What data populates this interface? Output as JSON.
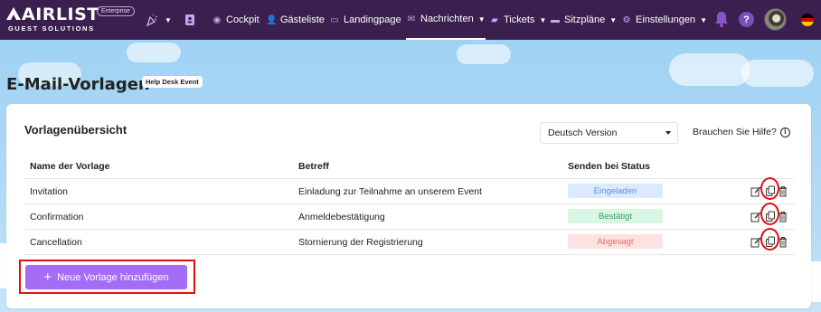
{
  "brand": {
    "name": "AIRLIST",
    "tagline": "GUEST SOLUTIONS",
    "badge": "Enterprise"
  },
  "nav": {
    "items": [
      {
        "label": "Cockpit",
        "icon": "dashboard-icon"
      },
      {
        "label": "Gästeliste",
        "icon": "guest-list-icon"
      },
      {
        "label": "Landingpage",
        "icon": "landingpage-icon"
      },
      {
        "label": "Nachrichten",
        "icon": "messages-icon",
        "active": true
      },
      {
        "label": "Tickets",
        "icon": "ticket-icon"
      },
      {
        "label": "Sitzpläne",
        "icon": "seating-icon"
      },
      {
        "label": "Einstellungen",
        "icon": "settings-icon"
      }
    ],
    "help": "?"
  },
  "page": {
    "title": "E-Mail-Vorlagen",
    "event_chip": "Help Desk Event"
  },
  "card": {
    "title": "Vorlagenübersicht",
    "language_select": "Deutsch Version",
    "help_link": "Brauchen Sie Hilfe?",
    "info": "i"
  },
  "table": {
    "headers": [
      "Name der Vorlage",
      "Betreff",
      "Senden bei Status"
    ],
    "rows": [
      {
        "name": "Invitation",
        "subject": "Einladung zur Teilnahme an unserem Event",
        "status": "Eingeladen"
      },
      {
        "name": "Confirmation",
        "subject": "Anmeldebestätigung",
        "status": "Bestätigt"
      },
      {
        "name": "Cancellation",
        "subject": "Stornierung der Registrierung",
        "status": "Abgesagt"
      }
    ]
  },
  "add_button": {
    "label": "Neue Vorlage hinzufügen",
    "plus": "+"
  },
  "colors": {
    "nav_bg": "#3b1f4e",
    "accent": "#a46df3",
    "highlight": "#e01010",
    "status_invited_bg": "#dbeafe",
    "status_invited_fg": "#5b8fd8",
    "status_confirmed_bg": "#d9f5e4",
    "status_confirmed_fg": "#33a466",
    "status_cancelled_bg": "#fde2e2",
    "status_cancelled_fg": "#e46a6a"
  }
}
